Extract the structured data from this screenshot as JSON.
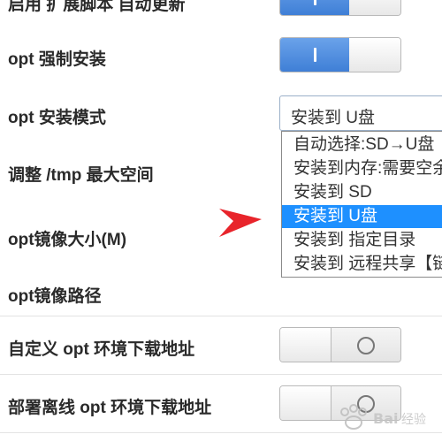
{
  "rows": [
    {
      "label": "启用 扩展脚本 自动更新",
      "toggle": "on"
    },
    {
      "label": "opt 强制安装",
      "toggle": "on"
    },
    {
      "label": "opt 安装模式"
    },
    {
      "label": "调整 /tmp 最大空间"
    },
    {
      "label": "opt镜像大小(M)"
    },
    {
      "label": "opt镜像路径"
    },
    {
      "label": "自定义 opt 环境下载地址",
      "toggle": "off"
    },
    {
      "label": "部署离线 opt 环境下载地址",
      "toggle": "off"
    }
  ],
  "install_mode": {
    "selected": "安装到 U盘",
    "options": [
      "自动选择:SD→U盘",
      "安装到内存:需要空余",
      "安装到 SD",
      "安装到 U盘",
      "安装到 指定目录",
      "安装到 远程共享【链接"
    ],
    "highlighted_index": 3
  },
  "colors": {
    "toggle_on": "#3f7fd6",
    "option_highlight": "#1e90ff",
    "arrow": "#e8242b"
  },
  "icons": {
    "pointer": "red-arrow-icon",
    "watermark": "baidu-jingyan-logo"
  }
}
